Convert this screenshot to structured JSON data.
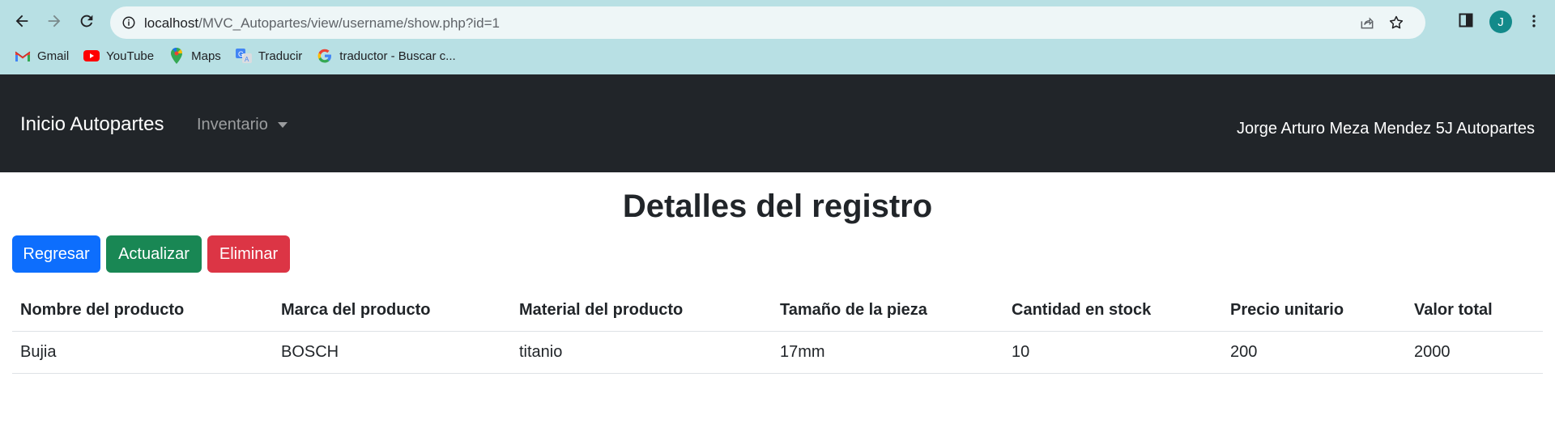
{
  "browser": {
    "url_host": "localhost",
    "url_path": "/MVC_Autopartes/view/username/show.php?id=1",
    "profile_initial": "J",
    "bookmarks": [
      {
        "label": "Gmail",
        "icon": "gmail-icon"
      },
      {
        "label": "YouTube",
        "icon": "youtube-icon"
      },
      {
        "label": "Maps",
        "icon": "maps-icon"
      },
      {
        "label": "Traducir",
        "icon": "translate-icon"
      },
      {
        "label": "traductor - Buscar c...",
        "icon": "google-icon"
      }
    ]
  },
  "navbar": {
    "brand": "Inicio Autopartes",
    "dropdown_label": "Inventario",
    "author": "Jorge Arturo Meza Mendez 5J Autopartes"
  },
  "page": {
    "title": "Detalles del registro",
    "buttons": {
      "back": "Regresar",
      "update": "Actualizar",
      "delete": "Eliminar"
    }
  },
  "table": {
    "headers": [
      "Nombre del producto",
      "Marca del producto",
      "Material del producto",
      "Tamaño de la pieza",
      "Cantidad en stock",
      "Precio unitario",
      "Valor total"
    ],
    "rows": [
      [
        "Bujia",
        "BOSCH",
        "titanio",
        "17mm",
        "10",
        "200",
        "2000"
      ]
    ]
  },
  "colors": {
    "navbar_bg": "#212529",
    "primary": "#0d6efd",
    "success": "#198754",
    "danger": "#dc3545",
    "browser_chrome": "#b8e0e4"
  }
}
